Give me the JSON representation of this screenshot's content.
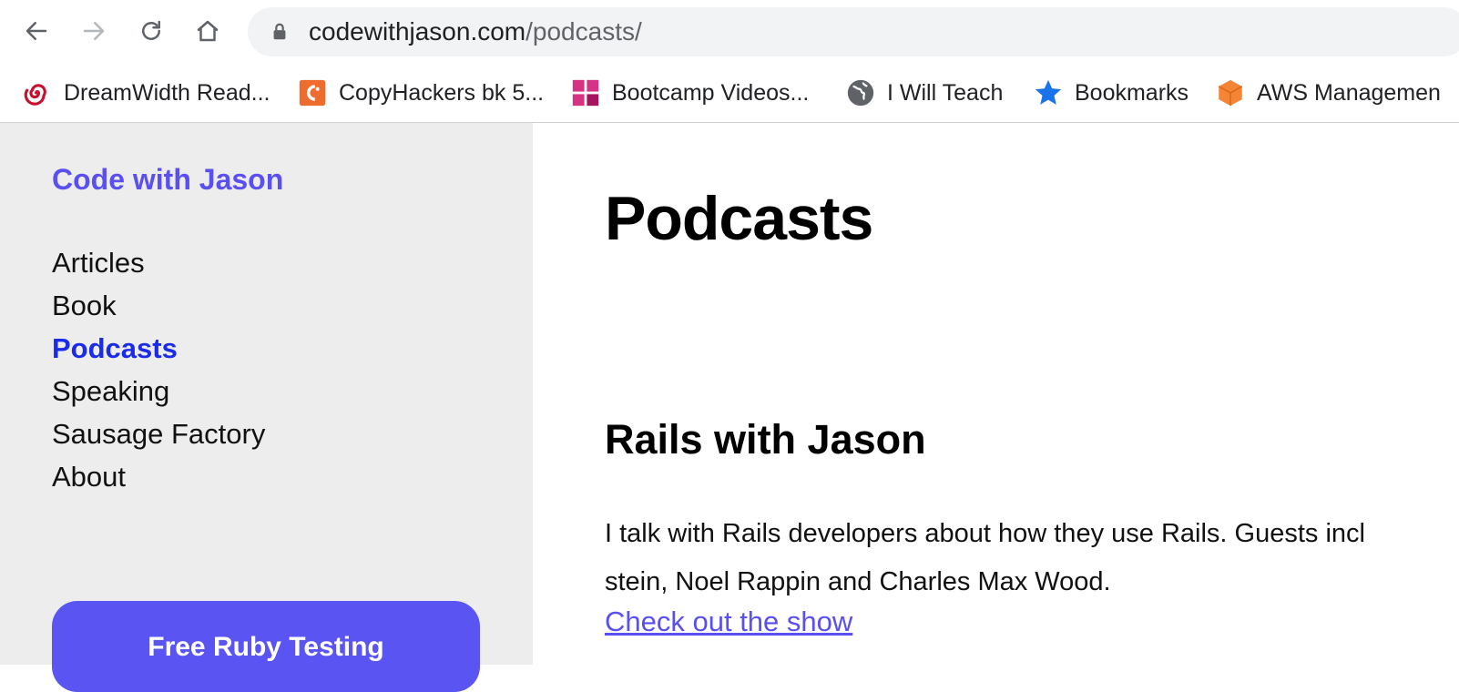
{
  "browser": {
    "url_host": "codewithjason.com",
    "url_path": "/podcasts/",
    "bookmarks": [
      {
        "label": "DreamWidth Read...",
        "icon": "dreamwidth-swirl-icon"
      },
      {
        "label": "CopyHackers bk 5...",
        "icon": "copyhackers-icon"
      },
      {
        "label": "Bootcamp Videos...",
        "icon": "bootcamp-grid-icon"
      },
      {
        "label": "I Will Teach",
        "icon": "globe-icon"
      },
      {
        "label": "Bookmarks",
        "icon": "star-icon"
      },
      {
        "label": "AWS Managemen",
        "icon": "aws-cube-icon"
      }
    ]
  },
  "sidebar": {
    "site_title": "Code with Jason",
    "nav": [
      {
        "label": "Articles"
      },
      {
        "label": "Book"
      },
      {
        "label": "Podcasts"
      },
      {
        "label": "Speaking"
      },
      {
        "label": "Sausage Factory"
      },
      {
        "label": "About"
      }
    ],
    "cta_label": "Free Ruby Testing"
  },
  "main": {
    "title": "Podcasts",
    "section_title": "Rails with Jason",
    "description_line1": "I talk with Rails developers about how they use Rails. Guests incl",
    "description_line2": "stein, Noel Rappin and Charles Max Wood.",
    "link_label": "Check out the show"
  },
  "colors": {
    "brand": "#5a4ff0",
    "active_nav": "#1a2ce8",
    "cta_bg": "#5a55f2",
    "sidebar_bg": "#ededed"
  }
}
